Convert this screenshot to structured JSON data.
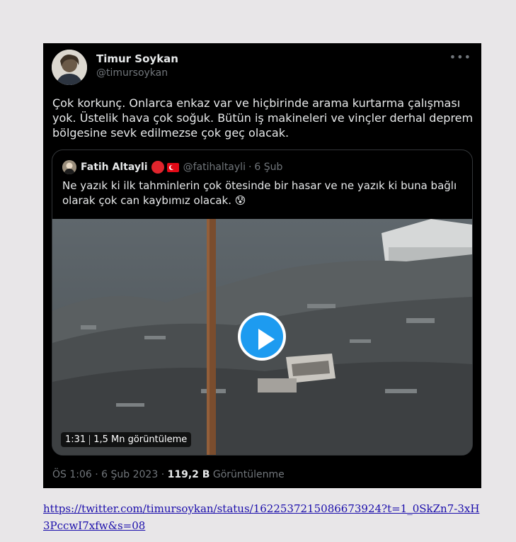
{
  "tweet": {
    "author": {
      "name": "Timur Soykan",
      "handle": "@timursoykan"
    },
    "more_icon": "more-horizontal-icon",
    "text": "Çok korkunç. Onlarca enkaz var ve hiçbirinde arama kurtarma çalışması yok. Üstelik hava çok soğuk. Bütün iş makineleri ve vinçler derhal deprem bölgesine sevk edilmezse çok geç olacak.",
    "quote": {
      "name": "Fatih Altayli",
      "handle": "@fatihaltayli",
      "separator": "·",
      "date": "6 Şub",
      "text": "Ne yazık ki ilk tahminlerin çok ötesinde bir hasar ve ne yazık ki buna bağlı olarak çok can kaybımız olacak. 😰",
      "media": {
        "duration": "1:31",
        "views": "1,5 Mn görüntüleme",
        "play_icon": "play-icon"
      }
    },
    "meta": {
      "time": "ÖS 1:06",
      "separator": "·",
      "date": "6 Şub 2023",
      "views_count": "119,2 B",
      "views_label": "Görüntülenme"
    }
  },
  "source_url": "https://twitter.com/timursoykan/status/1622537215086673924?t=1_0SkZn7-3xH3PccwI7xfw&s=08",
  "colors": {
    "card_background": "#000000",
    "primary_text": "#e7e9ea",
    "secondary_text": "#71767b",
    "play_button": "#1d9bf0",
    "link": "#1a0dab",
    "page_background": "#e8e6e8"
  }
}
